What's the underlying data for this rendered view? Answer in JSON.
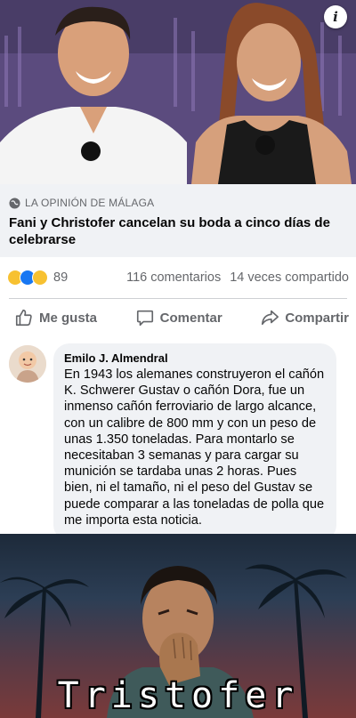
{
  "link_preview": {
    "source": "LA OPINIÓN DE MÁLAGA",
    "headline": "Fani y Christofer cancelan su boda a cinco días de celebrarse"
  },
  "stats": {
    "reaction_icons": [
      "haha-reaction-icon",
      "like-reaction-icon",
      "wow-reaction-icon"
    ],
    "reaction_count": "89",
    "comments": "116 comentarios",
    "shares": "14 veces compartido"
  },
  "actions": {
    "like": "Me gusta",
    "comment": "Comentar",
    "share": "Compartir"
  },
  "comment": {
    "author": "Emilo J. Almendral",
    "text": "En 1943 los alemanes construyeron el cañón K. Schwerer Gustav o cañón Dora, fue un inmenso cañón ferroviario de largo alcance, con un calibre de 800 mm y con un peso de unas 1.350 toneladas. Para montarlo se necesitaban 3 semanas y para cargar su munición se tardaba unas 2 horas. Pues bien, ni el tamaño, ni el peso del Gustav se puede comparar a las toneladas de polla que me importa esta noticia."
  },
  "meme_caption": "Tristofer",
  "colors": {
    "facebook_blue": "#1877f2",
    "muted_text": "#65676b",
    "preview_bg": "#f0f2f5"
  }
}
